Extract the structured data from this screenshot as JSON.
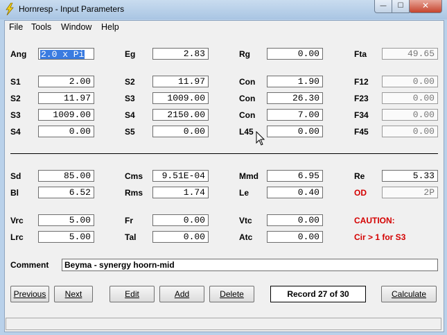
{
  "window": {
    "title": "Hornresp - Input Parameters",
    "min_glyph": "—",
    "max_glyph": "☐",
    "close_glyph": "✕"
  },
  "menu": [
    "File",
    "Tools",
    "Window",
    "Help"
  ],
  "horn": {
    "ang": {
      "label": "Ang",
      "value": "2.0 x Pi"
    },
    "eg": {
      "label": "Eg",
      "value": "2.83"
    },
    "rg": {
      "label": "Rg",
      "value": "0.00"
    },
    "fta": {
      "label": "Fta",
      "value": "49.65"
    },
    "row1": [
      {
        "label": "S1",
        "value": "2.00"
      },
      {
        "label": "S2",
        "value": "11.97"
      },
      {
        "label": "Con",
        "value": "1.90"
      },
      {
        "label": "F12",
        "value": "0.00"
      }
    ],
    "row2": [
      {
        "label": "S2",
        "value": "11.97"
      },
      {
        "label": "S3",
        "value": "1009.00"
      },
      {
        "label": "Con",
        "value": "26.30"
      },
      {
        "label": "F23",
        "value": "0.00"
      }
    ],
    "row3": [
      {
        "label": "S3",
        "value": "1009.00"
      },
      {
        "label": "S4",
        "value": "2150.00"
      },
      {
        "label": "Con",
        "value": "7.00"
      },
      {
        "label": "F34",
        "value": "0.00"
      }
    ],
    "row4": [
      {
        "label": "S4",
        "value": "0.00"
      },
      {
        "label": "S5",
        "value": "0.00"
      },
      {
        "label": "L45",
        "value": "0.00"
      },
      {
        "label": "F45",
        "value": "0.00"
      }
    ]
  },
  "driver": {
    "sd": {
      "label": "Sd",
      "value": "85.00"
    },
    "cms": {
      "label": "Cms",
      "value": "9.51E-04"
    },
    "mmd": {
      "label": "Mmd",
      "value": "6.95"
    },
    "re": {
      "label": "Re",
      "value": "5.33"
    },
    "bl": {
      "label": "Bl",
      "value": "6.52"
    },
    "rms": {
      "label": "Rms",
      "value": "1.74"
    },
    "le": {
      "label": "Le",
      "value": "0.40"
    },
    "od": {
      "label": "OD",
      "value": "2P"
    },
    "vrc": {
      "label": "Vrc",
      "value": "5.00"
    },
    "fr": {
      "label": "Fr",
      "value": "0.00"
    },
    "vtc": {
      "label": "Vtc",
      "value": "0.00"
    },
    "caution": "CAUTION:",
    "lrc": {
      "label": "Lrc",
      "value": "5.00"
    },
    "tal": {
      "label": "Tal",
      "value": "0.00"
    },
    "atc": {
      "label": "Atc",
      "value": "0.00"
    },
    "caution_msg": "Cir > 1 for S3"
  },
  "comment": {
    "label": "Comment",
    "value": "Beyma - synergy hoorn-mid"
  },
  "buttons": {
    "previous": "Previous",
    "next": "Next",
    "edit": "Edit",
    "add": "Add",
    "delete": "Delete",
    "calculate": "Calculate"
  },
  "record": "Record 27 of 30",
  "colors": {
    "warning": "#d40000",
    "selection": "#3a7be0"
  }
}
